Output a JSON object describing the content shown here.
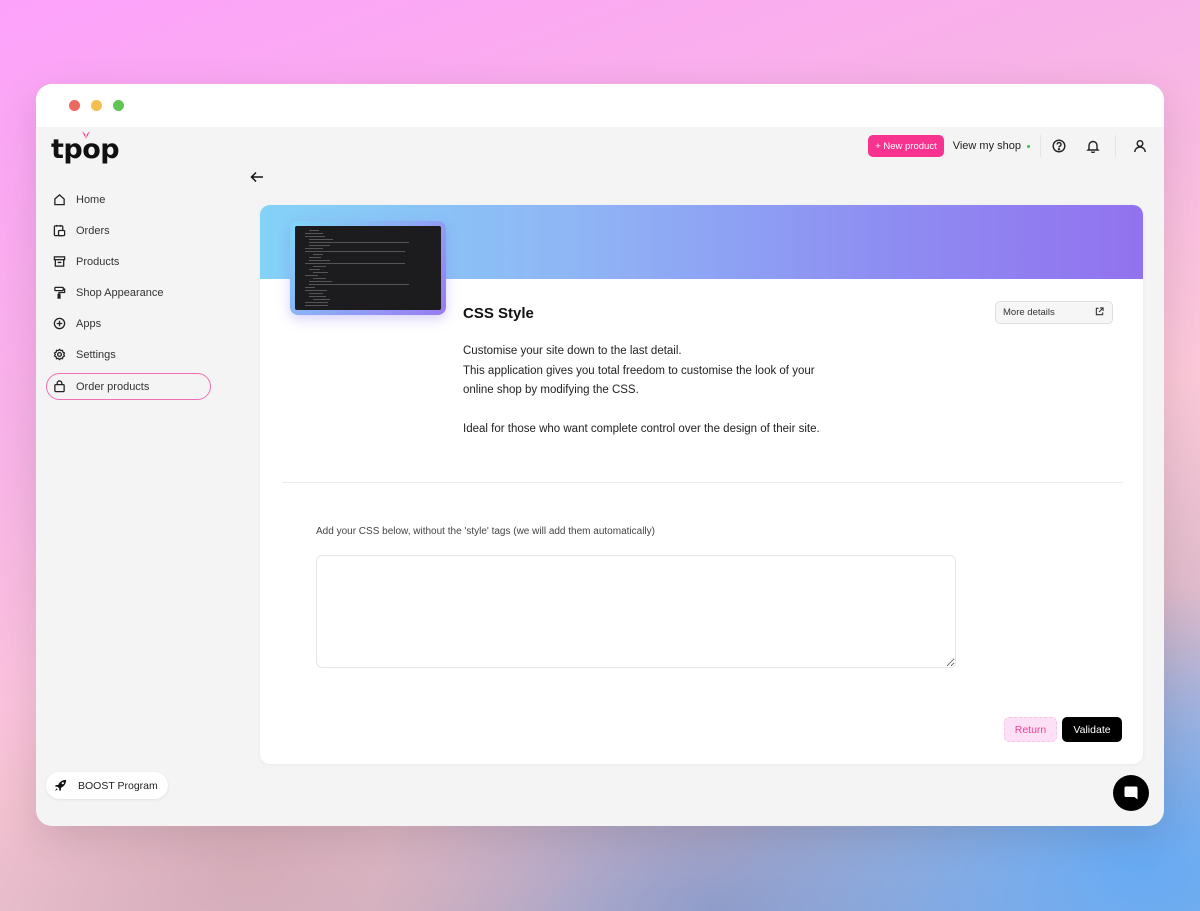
{
  "window": {
    "controls": [
      "close",
      "minimize",
      "maximize"
    ]
  },
  "brand": {
    "logo_text": "tpop",
    "accent_color": "#f7338f"
  },
  "sidebar": {
    "items": [
      {
        "label": "Home",
        "icon": "home-icon"
      },
      {
        "label": "Orders",
        "icon": "orders-icon"
      },
      {
        "label": "Products",
        "icon": "archive-icon"
      },
      {
        "label": "Shop Appearance",
        "icon": "paint-roller-icon"
      },
      {
        "label": "Apps",
        "icon": "plus-circle-icon"
      },
      {
        "label": "Settings",
        "icon": "gear-icon"
      },
      {
        "label": "Order products",
        "icon": "shopping-bag-icon",
        "active": true
      }
    ],
    "boost_label": "BOOST Program"
  },
  "topbar": {
    "new_product_label": "+ New product",
    "view_shop_label": "View my shop",
    "help_icon": "help-icon",
    "notifications_icon": "bell-icon",
    "account_icon": "user-icon"
  },
  "app": {
    "title": "CSS Style",
    "more_details_label": "More details",
    "description": [
      "Customise your site down to the last detail.\nThis application gives you total freedom to customise the look of your online shop by modifying the CSS.",
      "Ideal for those who want complete control over the design of their site."
    ],
    "css_label": "Add your CSS below, without the 'style' tags (we will add them automatically)",
    "css_value": "",
    "css_placeholder": "",
    "return_label": "Return",
    "validate_label": "Validate"
  }
}
